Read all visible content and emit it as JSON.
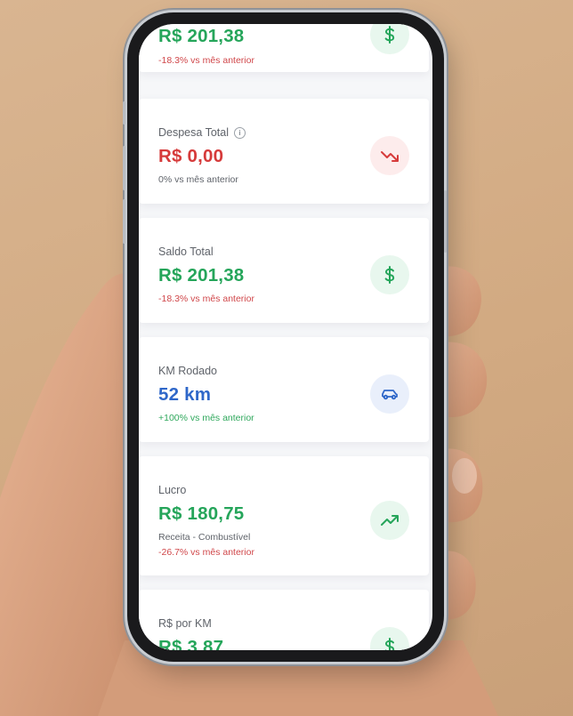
{
  "cards": [
    {
      "label": "",
      "value": "R$ 201,38",
      "compare": "-18.3% vs mês anterior",
      "icon": "dollar-icon"
    },
    {
      "label": "Despesa Total",
      "info_glyph": "i",
      "value": "R$ 0,00",
      "compare": "0% vs mês anterior",
      "icon": "trending-down-icon"
    },
    {
      "label": "Saldo Total",
      "value": "R$ 201,38",
      "compare": "-18.3% vs mês anterior",
      "icon": "dollar-icon"
    },
    {
      "label": "KM Rodado",
      "value": "52 km",
      "compare": "+100% vs mês anterior",
      "icon": "car-icon"
    },
    {
      "label": "Lucro",
      "value": "R$ 180,75",
      "note": "Receita - Combustível",
      "compare": "-26.7% vs mês anterior",
      "icon": "trending-up-icon"
    },
    {
      "label": "R$ por KM",
      "value": "R$ 3,87",
      "compare": "",
      "icon": "dollar-icon"
    }
  ],
  "colors": {
    "green": "#25a55a",
    "red": "#d63b3b",
    "blue": "#2f67c9",
    "green_bg": "#e8f7ee",
    "red_bg": "#fdecec",
    "blue_bg": "#e9effb"
  }
}
